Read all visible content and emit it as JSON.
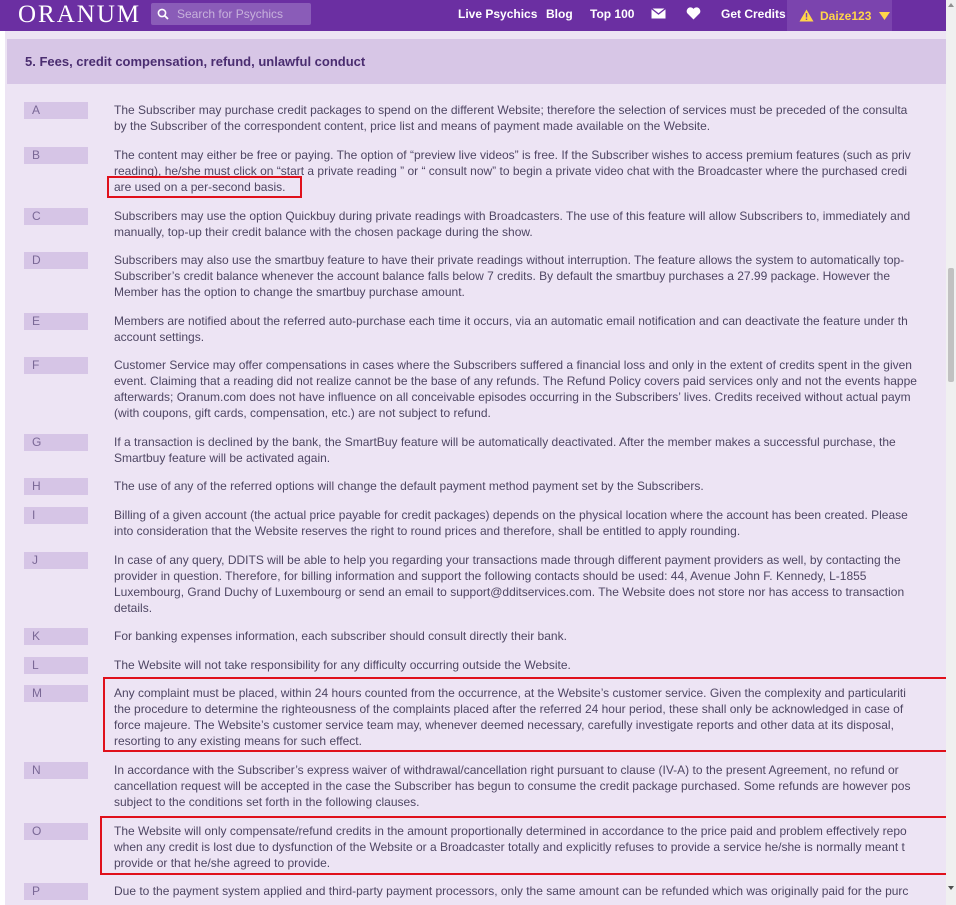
{
  "header": {
    "logo": "ORANUM",
    "search_placeholder": "Search for Psychics",
    "nav": [
      "Live Psychics",
      "Blog",
      "Top 100"
    ],
    "get_credits": "Get Credits",
    "username": "Daize123"
  },
  "section": {
    "title": "5. Fees, credit compensation, refund, unlawful conduct",
    "items": [
      {
        "letter": "A",
        "lines": [
          "The Subscriber may purchase credit packages to spend on the different Website; therefore the selection of services must be preceded of the consulta",
          "by the Subscriber of the correspondent content, price list and means of payment made available on the Website."
        ]
      },
      {
        "letter": "B",
        "lines": [
          "The content may either be free or paying. The option of “preview live videos” is free. If the Subscriber wishes to access premium features (such as priv",
          "reading), he/she must click on “start a private reading ” or “ consult now” to begin a private video chat with the Broadcaster where the purchased credi",
          "are used on a per-second basis."
        ]
      },
      {
        "letter": "C",
        "lines": [
          "Subscribers may use the option Quickbuy during private readings with Broadcasters. The use of this feature will allow Subscribers to, immediately and",
          "manually, top-up their credit balance with the chosen package during the show."
        ]
      },
      {
        "letter": "D",
        "lines": [
          "Subscribers may also use the smartbuy feature to have their private readings without interruption. The feature allows the system to automatically top-",
          "Subscriber’s credit balance whenever the account balance falls below 7 credits. By default the smartbuy purchases a 27.99 package. However the",
          "Member has the option to change the smartbuy purchase amount."
        ]
      },
      {
        "letter": "E",
        "lines": [
          "Members are notified about the referred auto-purchase each time it occurs, via an automatic email notification and can deactivate the feature under th",
          "account settings."
        ]
      },
      {
        "letter": "F",
        "lines": [
          "Customer Service may offer compensations in cases where the Subscribers suffered a financial loss and only in the extent of credits spent in the given",
          "event. Claiming that a reading did not realize cannot be the base of any refunds. The Refund Policy covers paid services only and not the events happe",
          "afterwards; Oranum.com does not have influence on all conceivable episodes occurring in the Subscribers’ lives. Credits received without actual paym",
          "(with coupons, gift cards, compensation, etc.) are not subject to refund."
        ]
      },
      {
        "letter": "G",
        "lines": [
          "If a transaction is declined by the bank, the SmartBuy feature will be automatically deactivated. After the member makes a successful purchase, the",
          "Smartbuy feature will be activated again."
        ]
      },
      {
        "letter": "H",
        "lines": [
          "The use of any of the referred options will change the default payment method payment set by the Subscribers."
        ]
      },
      {
        "letter": "I",
        "lines": [
          "Billing of a given account (the actual price payable for credit packages) depends on the physical location where the account has been created. Please",
          "into consideration that the Website reserves the right to round prices and therefore, shall be entitled to apply rounding."
        ]
      },
      {
        "letter": "J",
        "lines": [
          "In case of any query, DDITS will be able to help you regarding your transactions made through different payment providers as well, by contacting the",
          "provider in question. Therefore, for billing information and support the following contacts should be used: 44, Avenue John F. Kennedy, L-1855",
          "Luxembourg, Grand Duchy of Luxembourg or send an email to support@dditservices.com. The Website does not store nor has access to transaction",
          "details."
        ]
      },
      {
        "letter": "K",
        "lines": [
          "For banking expenses information, each subscriber should consult directly their bank."
        ]
      },
      {
        "letter": "L",
        "lines": [
          "The Website will not take responsibility for any difficulty occurring outside the Website."
        ]
      },
      {
        "letter": "M",
        "lines": [
          "Any complaint must be placed, within 24 hours counted from the occurrence, at the Website’s customer service. Given the complexity and particulariti",
          "the procedure to determine the righteousness of the complaints placed after the referred 24 hour period, these shall only be acknowledged in case of",
          "force majeure. The Website’s customer service team may, whenever deemed necessary, carefully investigate reports and other data at its disposal,",
          "resorting to any existing means for such effect."
        ]
      },
      {
        "letter": "N",
        "lines": [
          "In accordance with the Subscriber’s express waiver of withdrawal/cancellation right pursuant to clause (IV-A) to the present Agreement, no refund or",
          "cancellation request will be accepted in the case the Subscriber has begun to consume the credit package purchased. Some refunds are however pos",
          "subject to the conditions set forth in the following clauses."
        ]
      },
      {
        "letter": "O",
        "lines": [
          "The Website will only compensate/refund credits in the amount proportionally determined in accordance to the price paid and problem effectively repo",
          "when any credit is lost due to dysfunction of the Website or a Broadcaster totally and explicitly refuses to provide a service he/she is normally meant t",
          "provide or that he/she agreed to provide."
        ]
      },
      {
        "letter": "P",
        "lines": [
          "Due to the payment system applied and third-party payment processors, only the same amount can be refunded which was originally paid for the purc"
        ]
      }
    ]
  }
}
